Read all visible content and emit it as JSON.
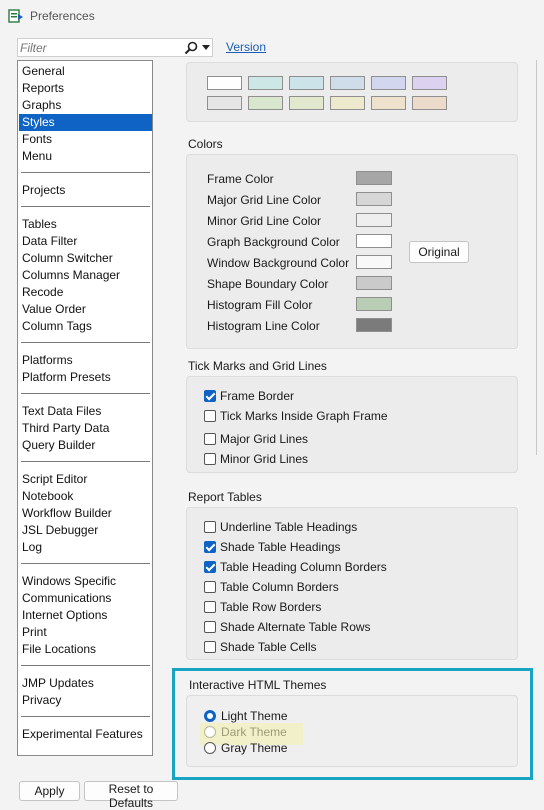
{
  "window": {
    "title": "Preferences",
    "icon": "preferences-app-icon"
  },
  "filter": {
    "placeholder": "Filter",
    "search_icon": "search-icon",
    "dropdown_icon": "chevron-down-icon"
  },
  "version_link": "Version",
  "nav": {
    "selected": "Styles",
    "items": [
      "General",
      "Reports",
      "Graphs",
      "Styles",
      "Fonts",
      "Menu",
      "Projects",
      "Tables",
      "Data Filter",
      "Column Switcher",
      "Columns Manager",
      "Recode",
      "Value Order",
      "Column Tags",
      "Platforms",
      "Platform Presets",
      "Text Data Files",
      "Third Party Data",
      "Query Builder",
      "Script Editor",
      "Notebook",
      "Workflow Builder",
      "JSL Debugger",
      "Log",
      "Windows Specific",
      "Communications",
      "Internet Options",
      "Print",
      "File Locations",
      "JMP Updates",
      "Privacy",
      "Experimental Features"
    ]
  },
  "palette": {
    "row1": [
      "#ffffff",
      "#cde7e7",
      "#cde3ea",
      "#cfdcea",
      "#d3d6ef",
      "#dcd1ef"
    ],
    "row2": [
      "#e6e6e6",
      "#d7e6cd",
      "#e1e8cd",
      "#ede9cd",
      "#eee2cd",
      "#ecdbcb"
    ]
  },
  "colors": {
    "title": "Colors",
    "items": [
      {
        "label": "Frame Color",
        "color": "#a6a6a6"
      },
      {
        "label": "Major Grid Line Color",
        "color": "#d6d6d6"
      },
      {
        "label": "Minor Grid Line Color",
        "color": "#efefef"
      },
      {
        "label": "Graph Background Color",
        "color": "#ffffff"
      },
      {
        "label": "Window Background Color",
        "color": "#f8f8f8"
      },
      {
        "label": "Shape Boundary Color",
        "color": "#cacaca"
      },
      {
        "label": "Histogram Fill Color",
        "color": "#b9cdb4"
      },
      {
        "label": "Histogram Line Color",
        "color": "#7b7b7b"
      }
    ],
    "original_button": "Original"
  },
  "tick_marks": {
    "title": "Tick Marks and Grid Lines",
    "items": [
      {
        "label": "Frame Border",
        "checked": true
      },
      {
        "label": "Tick Marks Inside Graph Frame",
        "checked": false
      },
      {
        "label": "Major Grid Lines",
        "checked": false
      },
      {
        "label": "Minor Grid Lines",
        "checked": false
      }
    ]
  },
  "report_tables": {
    "title": "Report Tables",
    "items": [
      {
        "label": "Underline Table Headings",
        "checked": false
      },
      {
        "label": "Shade Table Headings",
        "checked": true
      },
      {
        "label": "Table Heading Column Borders",
        "checked": true
      },
      {
        "label": "Table Column Borders",
        "checked": false
      },
      {
        "label": "Table Row Borders",
        "checked": false
      },
      {
        "label": "Shade Alternate Table Rows",
        "checked": false
      },
      {
        "label": "Shade Table Cells",
        "checked": false
      }
    ]
  },
  "html_themes": {
    "title": "Interactive HTML Themes",
    "options": [
      "Light Theme",
      "Dark Theme",
      "Gray Theme"
    ],
    "selected": "Light Theme",
    "highlighted": "Dark Theme",
    "highlight_color": "#fbf584",
    "focus_frame_color": "#1aa4c4"
  },
  "footer": {
    "apply": "Apply",
    "reset": "Reset to Defaults"
  },
  "accent_color": "#0f63c4"
}
